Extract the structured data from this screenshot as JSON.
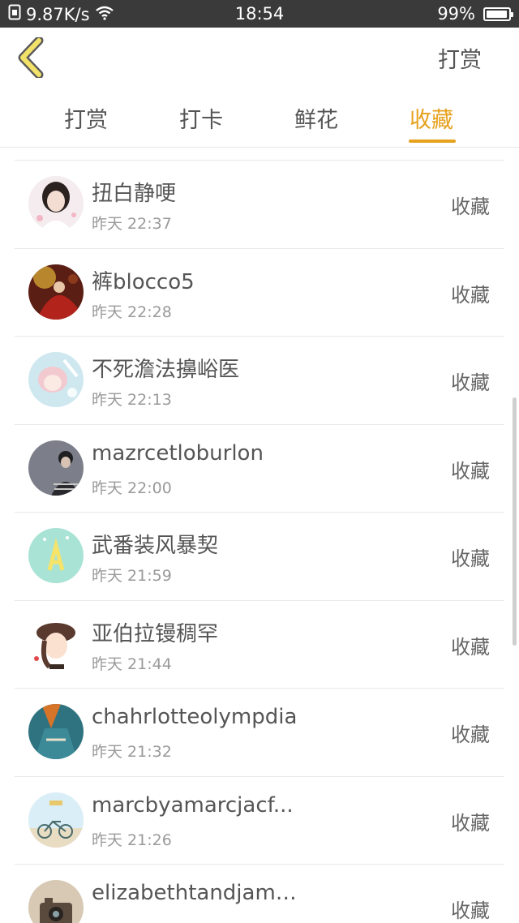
{
  "status_bar": {
    "speed": "9.87K/s",
    "time": "18:54",
    "battery": "99%",
    "battery_level": 0.99
  },
  "header": {
    "back_icon": "chevron-left-icon",
    "action_label": "打赏"
  },
  "tabs": [
    {
      "label": "打赏",
      "active": false
    },
    {
      "label": "打卡",
      "active": false
    },
    {
      "label": "鲜花",
      "active": false
    },
    {
      "label": "收藏",
      "active": true
    }
  ],
  "colors": {
    "accent": "#e6a11d",
    "status_bar_bg": "#3a3a3a",
    "back_icon_fill": "#f3e26a"
  },
  "rows": [
    {
      "name": "扭白静哽",
      "time": "昨天 22:37",
      "action": "收藏",
      "avatar": "avatar-girl-portrait"
    },
    {
      "name": "裤blocco5",
      "time": "昨天 22:28",
      "action": "收藏",
      "avatar": "avatar-red-painting"
    },
    {
      "name": "不死澹法擤峪医",
      "time": "昨天 22:13",
      "action": "收藏",
      "avatar": "avatar-anime-girl"
    },
    {
      "name": "mazrcetloburlon",
      "time": "昨天 22:00",
      "action": "收藏",
      "avatar": "avatar-boy-dark"
    },
    {
      "name": "武番装风暴契",
      "time": "昨天 21:59",
      "action": "收藏",
      "avatar": "avatar-letter-a"
    },
    {
      "name": "亚伯拉镘稠罕",
      "time": "昨天 21:44",
      "action": "收藏",
      "avatar": "avatar-cartoon-girl"
    },
    {
      "name": "chahrlotteolympdia",
      "time": "昨天 21:32",
      "action": "收藏",
      "avatar": "avatar-teal-fashion"
    },
    {
      "name": "marcbyamarcjacf...",
      "time": "昨天 21:26",
      "action": "收藏",
      "avatar": "avatar-bicycle"
    },
    {
      "name": "elizabethtandjame...",
      "time": "",
      "action": "收藏",
      "avatar": "avatar-camera"
    }
  ]
}
